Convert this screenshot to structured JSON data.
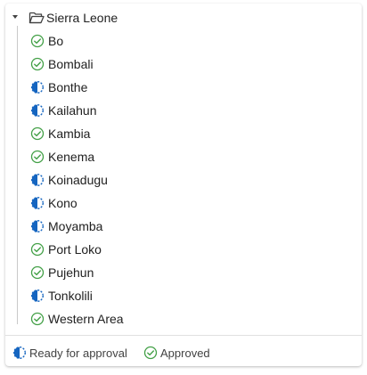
{
  "tree": {
    "root_label": "Sierra Leone",
    "items": [
      {
        "label": "Bo",
        "status": "approved"
      },
      {
        "label": "Bombali",
        "status": "approved"
      },
      {
        "label": "Bonthe",
        "status": "ready"
      },
      {
        "label": "Kailahun",
        "status": "ready"
      },
      {
        "label": "Kambia",
        "status": "approved"
      },
      {
        "label": "Kenema",
        "status": "approved"
      },
      {
        "label": "Koinadugu",
        "status": "ready"
      },
      {
        "label": "Kono",
        "status": "ready"
      },
      {
        "label": "Moyamba",
        "status": "ready"
      },
      {
        "label": "Port Loko",
        "status": "approved"
      },
      {
        "label": "Pujehun",
        "status": "approved"
      },
      {
        "label": "Tonkolili",
        "status": "ready"
      },
      {
        "label": "Western Area",
        "status": "approved"
      }
    ]
  },
  "legend": {
    "ready_label": "Ready for approval",
    "approved_label": "Approved"
  },
  "colors": {
    "approved": "#43a047",
    "ready": "#1565c0"
  },
  "icons": {
    "root": "folder-open-icon",
    "expand": "caret-down-icon",
    "approved": "check-circle-icon",
    "ready": "half-circle-icon"
  }
}
